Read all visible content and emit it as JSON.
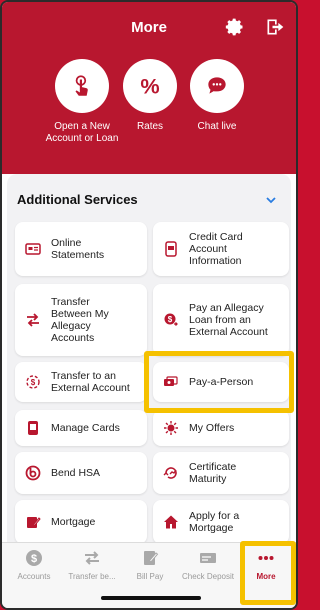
{
  "colors": {
    "brand": "#b8172f",
    "highlight": "#f5c100",
    "panel_bg": "#f2f2f4"
  },
  "header": {
    "title": "More",
    "settings_icon": "gear-icon",
    "logout_icon": "logout-icon"
  },
  "quick_actions": [
    {
      "label": "Open a New Account or Loan",
      "icon": "tap-hand-icon"
    },
    {
      "label": "Rates",
      "icon": "percent-icon"
    },
    {
      "label": "Chat live",
      "icon": "chat-bubble-icon"
    }
  ],
  "section": {
    "title": "Additional Services",
    "icon": "chevron-down-icon"
  },
  "services": [
    {
      "label": "Online Statements",
      "icon": "statement-icon"
    },
    {
      "label": "Credit Card Account Information",
      "icon": "credit-card-phone-icon"
    },
    {
      "label": "Transfer Between My Allegacy Accounts",
      "icon": "transfer-arrows-icon"
    },
    {
      "label": "Pay an Allegacy Loan from an External Account",
      "icon": "loan-pay-icon"
    },
    {
      "label": "Transfer to an External Account",
      "icon": "external-transfer-icon"
    },
    {
      "label": "Pay-a-Person",
      "icon": "pay-person-icon"
    },
    {
      "label": "Manage Cards",
      "icon": "card-phone-icon"
    },
    {
      "label": "My Offers",
      "icon": "offers-icon"
    },
    {
      "label": "Bend HSA",
      "icon": "hsa-icon"
    },
    {
      "label": "Certificate Maturity",
      "icon": "certificate-icon"
    },
    {
      "label": "Mortgage",
      "icon": "mortgage-icon"
    },
    {
      "label": "Apply for a Mortgage",
      "icon": "house-icon"
    }
  ],
  "tabs": [
    {
      "label": "Accounts",
      "icon": "dollar-icon",
      "active": false
    },
    {
      "label": "Transfer be...",
      "icon": "transfer-icon",
      "active": false
    },
    {
      "label": "Bill Pay",
      "icon": "bill-pay-icon",
      "active": false
    },
    {
      "label": "Check Deposit",
      "icon": "check-deposit-icon",
      "active": false
    },
    {
      "label": "More",
      "icon": "more-dots-icon",
      "active": true
    }
  ]
}
